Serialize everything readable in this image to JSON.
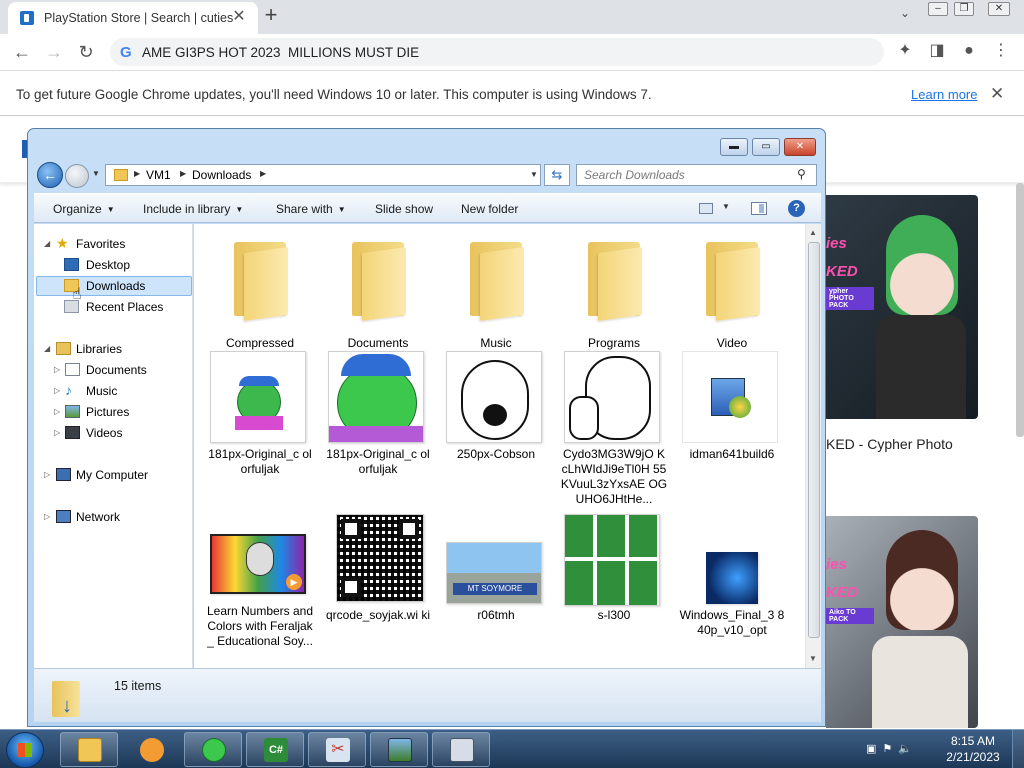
{
  "browser": {
    "tab_title": "PlayStation Store | Search | cuties",
    "tab_close": "✕",
    "new_tab": "+",
    "omnibox_text": "AME GI3PS HOT 2023  MILLIONS MUST DIE",
    "update_message": "To get future Google Chrome updates, you'll need Windows 10 or later. This computer is using Windows 7.",
    "update_link": "Learn more",
    "update_close": "✕"
  },
  "page_behind": {
    "card_badge": "ies",
    "card_badge2": "KED",
    "card1_sub": "ypher PHOTO PACK",
    "card2_sub": "Aiko TO PACK",
    "card1_title": "KED - Cypher Photo"
  },
  "explorer": {
    "breadcrumb": [
      "VM1",
      "Downloads"
    ],
    "search_placeholder": "Search Downloads",
    "commands": {
      "organize": "Organize",
      "include_in_library": "Include in library",
      "share_with": "Share with",
      "slide_show": "Slide show",
      "new_folder": "New folder",
      "help": "?"
    },
    "nav": {
      "favorites": "Favorites",
      "desktop": "Desktop",
      "downloads": "Downloads",
      "recent_places": "Recent Places",
      "libraries": "Libraries",
      "documents": "Documents",
      "music": "Music",
      "pictures": "Pictures",
      "videos": "Videos",
      "my_computer": "My Computer",
      "network": "Network"
    },
    "items": [
      {
        "name": "Compressed",
        "kind": "folder"
      },
      {
        "name": "Documents",
        "kind": "folder"
      },
      {
        "name": "Music",
        "kind": "folder"
      },
      {
        "name": "Programs",
        "kind": "folder"
      },
      {
        "name": "Video",
        "kind": "folder"
      },
      {
        "name": "181px-Original_c olorfuljak",
        "kind": "image"
      },
      {
        "name": "181px-Original_c olorfuljak",
        "kind": "image"
      },
      {
        "name": "250px-Cobson",
        "kind": "image"
      },
      {
        "name": "Cydo3MG3W9jO KcLhWIdJi9eTl0H 55KVuuL3zYxsAE OGUHO6JHtHe...",
        "kind": "image"
      },
      {
        "name": "idman641build6",
        "kind": "installer"
      },
      {
        "name": "Learn Numbers and Colors with Feraljak _ Educational Soy...",
        "kind": "video"
      },
      {
        "name": "qrcode_soyjak.wi ki",
        "kind": "image"
      },
      {
        "name": "r06tmh",
        "kind": "image"
      },
      {
        "name": "s-l300",
        "kind": "image"
      },
      {
        "name": "Windows_Final_3 840p_v10_opt",
        "kind": "image"
      }
    ],
    "item_count": "15 items"
  },
  "taskbar": {
    "time": "8:15 AM",
    "date": "2/21/2023"
  }
}
